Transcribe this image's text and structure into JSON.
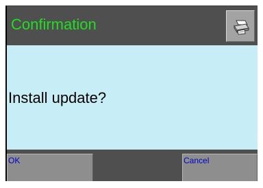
{
  "dialog": {
    "title": "Confirmation",
    "title_color": "#1ee01e",
    "message": "Install update?",
    "print_button": {
      "icon": "printer-icon"
    }
  },
  "buttons": {
    "ok_label": "OK",
    "cancel_label": "Cancel",
    "label_color": "#0000cc"
  },
  "colors": {
    "frame": "#4f4f4f",
    "content_background": "#c7edf7",
    "button_face": "#8e8e8e"
  }
}
